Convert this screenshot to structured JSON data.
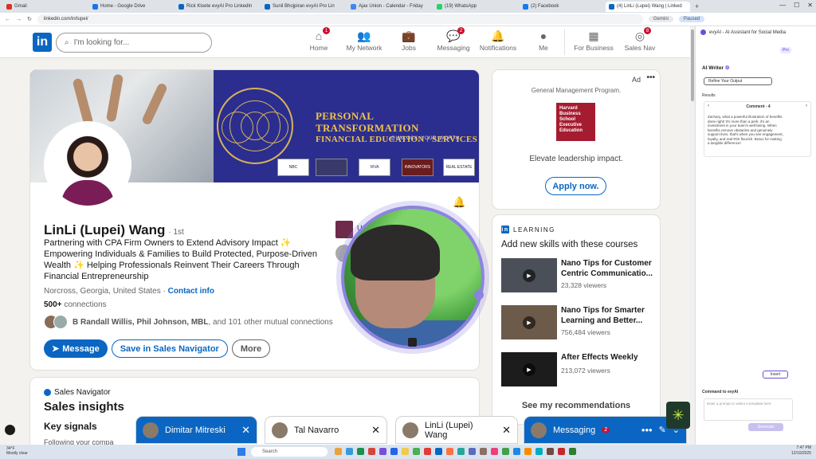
{
  "browser": {
    "tabs": [
      {
        "label": "Gmail",
        "color": "#d93025"
      },
      {
        "label": "Home - Google Drive",
        "color": "#1a73e8"
      },
      {
        "label": "Rick Kloete evyAI Pro LinkedIn",
        "color": "#0a66c2"
      },
      {
        "label": "Sunil Bhojpiran evyAI Pro Lin",
        "color": "#0a66c2"
      },
      {
        "label": "Ajax Union - Calendar - Friday",
        "color": "#4285f4"
      },
      {
        "label": "(19) WhatsApp",
        "color": "#25d366"
      },
      {
        "label": "(2) Facebook",
        "color": "#1877f2"
      },
      {
        "label": "(4) LinLi (Lupei) Wang | Linked",
        "color": "#0a66c2",
        "active": true
      }
    ],
    "url": "linkedin.com/in/lupei/",
    "gemini_label": "Gemini",
    "profile_label": "Paused"
  },
  "nav": {
    "search_placeholder": "I'm looking for...",
    "items": [
      {
        "label": "Home",
        "icon": "home-icon",
        "glyph": "⌂",
        "badge": "1"
      },
      {
        "label": "My Network",
        "icon": "network-icon",
        "glyph": "👥",
        "badge": ""
      },
      {
        "label": "Jobs",
        "icon": "briefcase-icon",
        "glyph": "💼",
        "badge": ""
      },
      {
        "label": "Messaging",
        "icon": "messaging-icon",
        "glyph": "💬",
        "badge": "2"
      },
      {
        "label": "Notifications",
        "icon": "bell-icon",
        "glyph": "🔔",
        "badge": ""
      },
      {
        "label": "Me",
        "icon": "avatar-icon",
        "glyph": "●",
        "badge": ""
      },
      {
        "label": "For Business",
        "icon": "grid-icon",
        "glyph": "▦",
        "badge": ""
      },
      {
        "label": "Sales Nav",
        "icon": "compass-icon",
        "glyph": "◎",
        "badge": "8"
      }
    ]
  },
  "profile": {
    "banner_title_1": "PERSONAL TRANSFORMATION",
    "banner_title_2": "FINANCIAL EDUCATION / SERVICES",
    "banner_handle": "@UNLOCK_YOUR_WORTH",
    "name": "LinLi (Lupei) Wang",
    "degree": "· 1st",
    "headline": "Partnering with CPA Firm Owners to Extend Advisory Impact ✨ Empowering Individuals & Families to Build Protected, Purpose-Driven Wealth ✨ Helping Professionals Reinvent Their Careers Through Financial Entrepreneurship",
    "location": "Norcross, Georgia, United States ·",
    "contact_info": "Contact info",
    "connections_count": "500+",
    "connections_label": "connections",
    "mutual_names": "B Randall Willis, Phil Johnson, MBL",
    "mutual_rest": ", and 101 other mutual connections",
    "org_1_text": "Unlo",
    "message_label": "Message",
    "save_label": "Save in Sales Navigator",
    "more_label": "More"
  },
  "sales_nav": {
    "brand": "Sales Navigator",
    "title": "Sales insights",
    "key_signals": "Key signals",
    "following": "Following your compa"
  },
  "ad": {
    "label": "Ad",
    "program": "General Management Program.",
    "logo_text": "Harvard Business School Executive Education",
    "tagline": "Elevate leadership impact.",
    "cta": "Apply now."
  },
  "learning": {
    "heading": "LEARNING",
    "subtitle": "Add new skills with these courses",
    "courses": [
      {
        "title": "Nano Tips for Customer Centric Communicatio...",
        "viewers": "23,328 viewers"
      },
      {
        "title": "Nano Tips for Smarter Learning and Better...",
        "viewers": "756,484 viewers"
      },
      {
        "title": "After Effects Weekly",
        "viewers": "213,072 viewers"
      }
    ],
    "see_recs": "See my recommendations"
  },
  "chats": [
    {
      "name": "Dimitar Mitreski",
      "active": true
    },
    {
      "name": "Tal Navarro",
      "active": false
    },
    {
      "name": "LinLi (Lupei) Wang",
      "active": false
    }
  ],
  "messaging": {
    "label": "Messaging",
    "badge": "2"
  },
  "evyai": {
    "title": "evyAI - AI Assistant for Social Media",
    "pro": "Pro",
    "writer": "AI Writer",
    "refine": "Refine Your Output",
    "results": "Results",
    "comment_title": "Comment - 4",
    "comment_text": "Zachary, what a powerful illustration of benefits done right! It's more than a perk; it's an investment in your team's well-being. When benefits remove obstacles and genuinely support lives, that's when you see engagement, loyalty, and real ROI flourish. Bravo for making a tangible difference!",
    "insert": "Insert",
    "command": "Command to evyAI",
    "prompt_placeholder": "Enter a prompt or select a template here",
    "generate": "Generate"
  },
  "taskbar": {
    "weather_1": "34°F",
    "weather_2": "Mostly clear",
    "search": "Search",
    "time": "7:47 PM",
    "date": "12/10/2025"
  }
}
